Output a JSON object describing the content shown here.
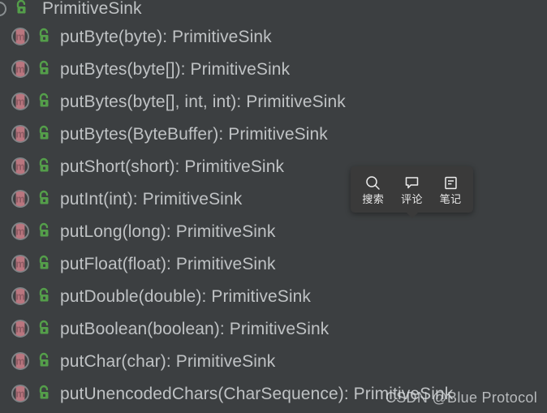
{
  "editor": {
    "background_color": "#3c3f41",
    "text_color": "#bfc2c4",
    "method_icon_color": "#b9767f",
    "lock_icon_color": "#549e4a"
  },
  "structure_tree": {
    "root": {
      "label": "PrimitiveSink",
      "icon": "interface-icon",
      "modifier_icon": "unlock-icon"
    },
    "members": [
      {
        "label": "putByte(byte): PrimitiveSink",
        "icon": "method-icon",
        "modifier_icon": "unlock-icon"
      },
      {
        "label": "putBytes(byte[]): PrimitiveSink",
        "icon": "method-icon",
        "modifier_icon": "unlock-icon"
      },
      {
        "label": "putBytes(byte[], int, int): PrimitiveSink",
        "icon": "method-icon",
        "modifier_icon": "unlock-icon"
      },
      {
        "label": "putBytes(ByteBuffer): PrimitiveSink",
        "icon": "method-icon",
        "modifier_icon": "unlock-icon"
      },
      {
        "label": "putShort(short): PrimitiveSink",
        "icon": "method-icon",
        "modifier_icon": "unlock-icon"
      },
      {
        "label": "putInt(int): PrimitiveSink",
        "icon": "method-icon",
        "modifier_icon": "unlock-icon"
      },
      {
        "label": "putLong(long): PrimitiveSink",
        "icon": "method-icon",
        "modifier_icon": "unlock-icon"
      },
      {
        "label": "putFloat(float): PrimitiveSink",
        "icon": "method-icon",
        "modifier_icon": "unlock-icon"
      },
      {
        "label": "putDouble(double): PrimitiveSink",
        "icon": "method-icon",
        "modifier_icon": "unlock-icon"
      },
      {
        "label": "putBoolean(boolean): PrimitiveSink",
        "icon": "method-icon",
        "modifier_icon": "unlock-icon"
      },
      {
        "label": "putChar(char): PrimitiveSink",
        "icon": "method-icon",
        "modifier_icon": "unlock-icon"
      },
      {
        "label": "putUnencodedChars(CharSequence): PrimitiveSink",
        "icon": "method-icon",
        "modifier_icon": "unlock-icon"
      }
    ]
  },
  "csdn_toolbar": {
    "background_color": "#3a3a3a",
    "items": [
      {
        "label": "搜索",
        "icon": "search-icon"
      },
      {
        "label": "评论",
        "icon": "comment-icon"
      },
      {
        "label": "笔记",
        "icon": "note-icon"
      }
    ]
  },
  "watermark": {
    "text": "CSDN @Blue Protocol"
  }
}
